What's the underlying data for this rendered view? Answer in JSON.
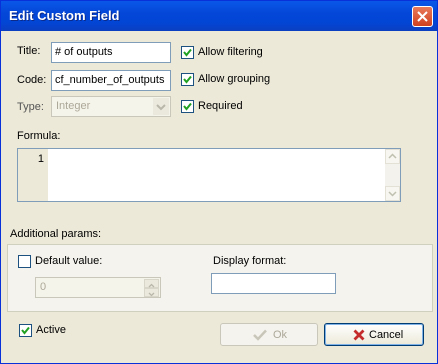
{
  "window": {
    "title": "Edit Custom Field"
  },
  "form": {
    "title_label": "Title:",
    "title_value": "# of outputs",
    "code_label": "Code:",
    "code_value": "cf_number_of_outputs",
    "type_label": "Type:",
    "type_value": "Integer",
    "formula_label": "Formula:",
    "line_number": "1",
    "allow_filtering": {
      "label": "Allow filtering",
      "checked": true
    },
    "allow_grouping": {
      "label": "Allow grouping",
      "checked": true
    },
    "required": {
      "label": "Required",
      "checked": true
    }
  },
  "params": {
    "label": "Additional params:",
    "default_value": {
      "label": "Default value:",
      "checked": false,
      "value": "0"
    },
    "display_format_label": "Display format:",
    "display_format_value": ""
  },
  "footer": {
    "active": {
      "label": "Active",
      "checked": true
    },
    "ok_label": "Ok",
    "cancel_label": "Cancel"
  },
  "colors": {
    "titlebar": "#0a58e8",
    "window_bg": "#ece9d8",
    "check_green": "#21a121",
    "cancel_x": "#c42b2b"
  }
}
